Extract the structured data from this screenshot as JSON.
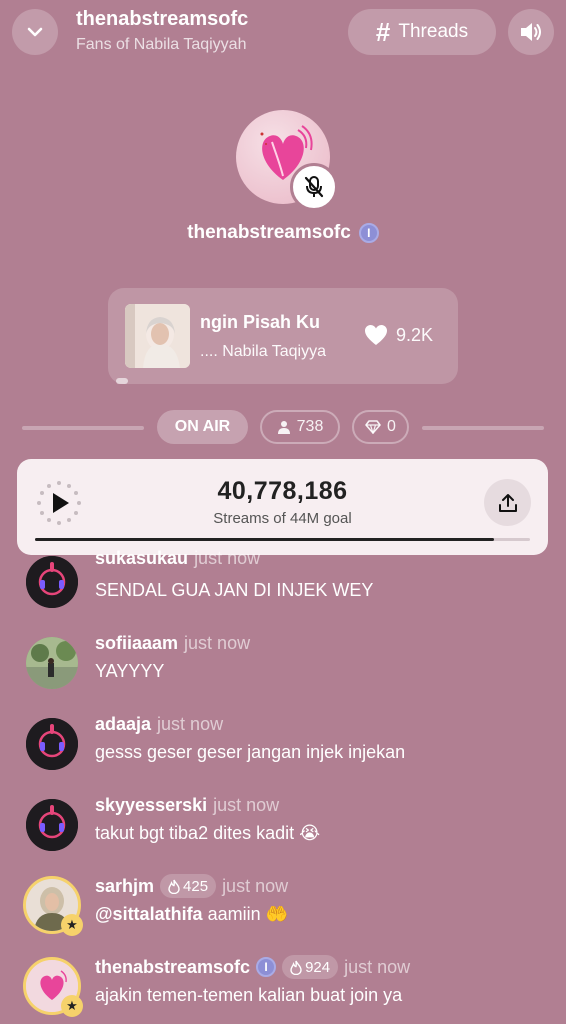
{
  "header": {
    "title": "thenabstreamsofc",
    "subtitle": "Fans of Nabila Taqiyyah",
    "threads_label": "Threads",
    "threads_icon": "hash-icon"
  },
  "host": {
    "name": "thenabstreamsofc",
    "verified_badge": "I",
    "mic": "muted"
  },
  "song": {
    "title": "ngin Pisah    Ku",
    "artist": ".... Nabila Taqiyya",
    "likes": "9.2K"
  },
  "status": {
    "on_air": "ON AIR",
    "listeners": "738",
    "gems": "0"
  },
  "stream": {
    "count": "40,778,186",
    "goal_text": "Streams of 44M goal",
    "progress": 0.927
  },
  "messages": [
    {
      "user": "sukasukau",
      "time": "just now",
      "text": "SENDAL GUA JAN DI INJEK WEY"
    },
    {
      "user": "sofiiaaam",
      "time": "just now",
      "text": "YAYYYY"
    },
    {
      "user": "adaaja",
      "time": "just now",
      "text": "gesss geser geser jangan injek injekan"
    },
    {
      "user": "skyyesserski",
      "time": "just now",
      "text": "takut bgt tiba2 dites kadit 😭"
    },
    {
      "user": "sarhjm",
      "fire": "425",
      "time": "just now",
      "mention": "@sittalathifa",
      "text": "aamiin 🤲"
    },
    {
      "user": "thenabstreamsofc",
      "badge": "I",
      "fire": "924",
      "time": "just now",
      "text": "ajakin temen-temen kalian buat join ya"
    }
  ],
  "colors": {
    "background": "#b17f92",
    "card": "#f7eef1",
    "gold": "#f6d26b",
    "verified": "#8d8fd6"
  }
}
